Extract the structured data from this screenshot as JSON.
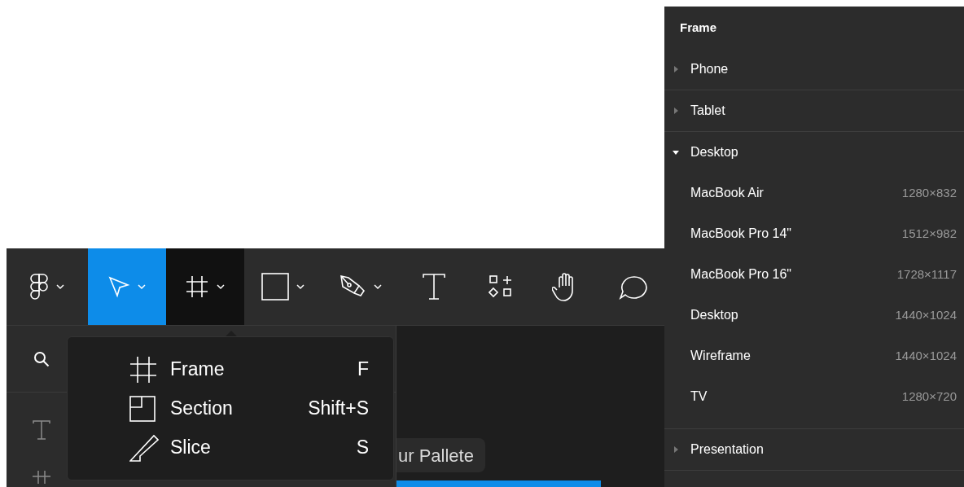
{
  "toolbar": {
    "tools": [
      {
        "kind": "logo",
        "selected": false,
        "expanded": false,
        "caret": true
      },
      {
        "kind": "move",
        "selected": true,
        "expanded": false,
        "caret": true
      },
      {
        "kind": "frame",
        "selected": false,
        "expanded": true,
        "caret": true
      },
      {
        "kind": "shape",
        "selected": false,
        "expanded": false,
        "caret": true
      },
      {
        "kind": "pen",
        "selected": false,
        "expanded": false,
        "caret": true
      },
      {
        "kind": "text",
        "selected": false,
        "expanded": false,
        "caret": false
      },
      {
        "kind": "resources",
        "selected": false,
        "expanded": false,
        "caret": false
      },
      {
        "kind": "hand",
        "selected": false,
        "expanded": false,
        "caret": false
      },
      {
        "kind": "comment",
        "selected": false,
        "expanded": false,
        "caret": false
      }
    ]
  },
  "layers_panel": {
    "items": [
      {
        "kind": "text"
      },
      {
        "kind": "frame"
      }
    ]
  },
  "canvas": {
    "chip": "ur Pallete"
  },
  "frame_menu": {
    "items": [
      {
        "kind": "frame",
        "label": "Frame",
        "shortcut": "F"
      },
      {
        "kind": "section",
        "label": "Section",
        "shortcut": "Shift+S"
      },
      {
        "kind": "slice",
        "label": "Slice",
        "shortcut": "S"
      }
    ]
  },
  "frame_panel": {
    "title": "Frame",
    "groups": [
      {
        "label": "Phone",
        "expanded": false
      },
      {
        "label": "Tablet",
        "expanded": false
      },
      {
        "label": "Desktop",
        "expanded": true,
        "presets": [
          {
            "name": "MacBook Air",
            "size": "1280×832"
          },
          {
            "name": "MacBook Pro 14\"",
            "size": "1512×982"
          },
          {
            "name": "MacBook Pro 16\"",
            "size": "1728×1117"
          },
          {
            "name": "Desktop",
            "size": "1440×1024"
          },
          {
            "name": "Wireframe",
            "size": "1440×1024"
          },
          {
            "name": "TV",
            "size": "1280×720"
          }
        ]
      },
      {
        "label": "Presentation",
        "expanded": false
      }
    ]
  }
}
